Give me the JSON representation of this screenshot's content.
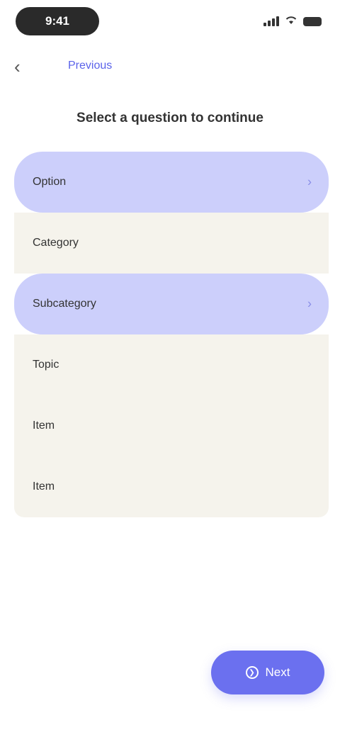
{
  "status_bar": {
    "time": "9:41"
  },
  "nav": {
    "back_icon": "chevron-left-icon",
    "link_label": "Previous"
  },
  "page": {
    "title": "Select a question to continue"
  },
  "options": [
    {
      "label": "Option",
      "selected": true
    },
    {
      "label": "Category",
      "selected": false
    },
    {
      "label": "Subcategory",
      "selected": true
    },
    {
      "label": "Topic",
      "selected": false
    },
    {
      "label": "Item",
      "selected": false
    },
    {
      "label": "Item",
      "selected": false
    }
  ],
  "footer": {
    "next_label": "Next",
    "next_icon": "arrow-icon"
  },
  "colors": {
    "accent": "#6b70ef",
    "selected_bg": "#cccffb",
    "plain_bg": "#f5f3ec"
  }
}
